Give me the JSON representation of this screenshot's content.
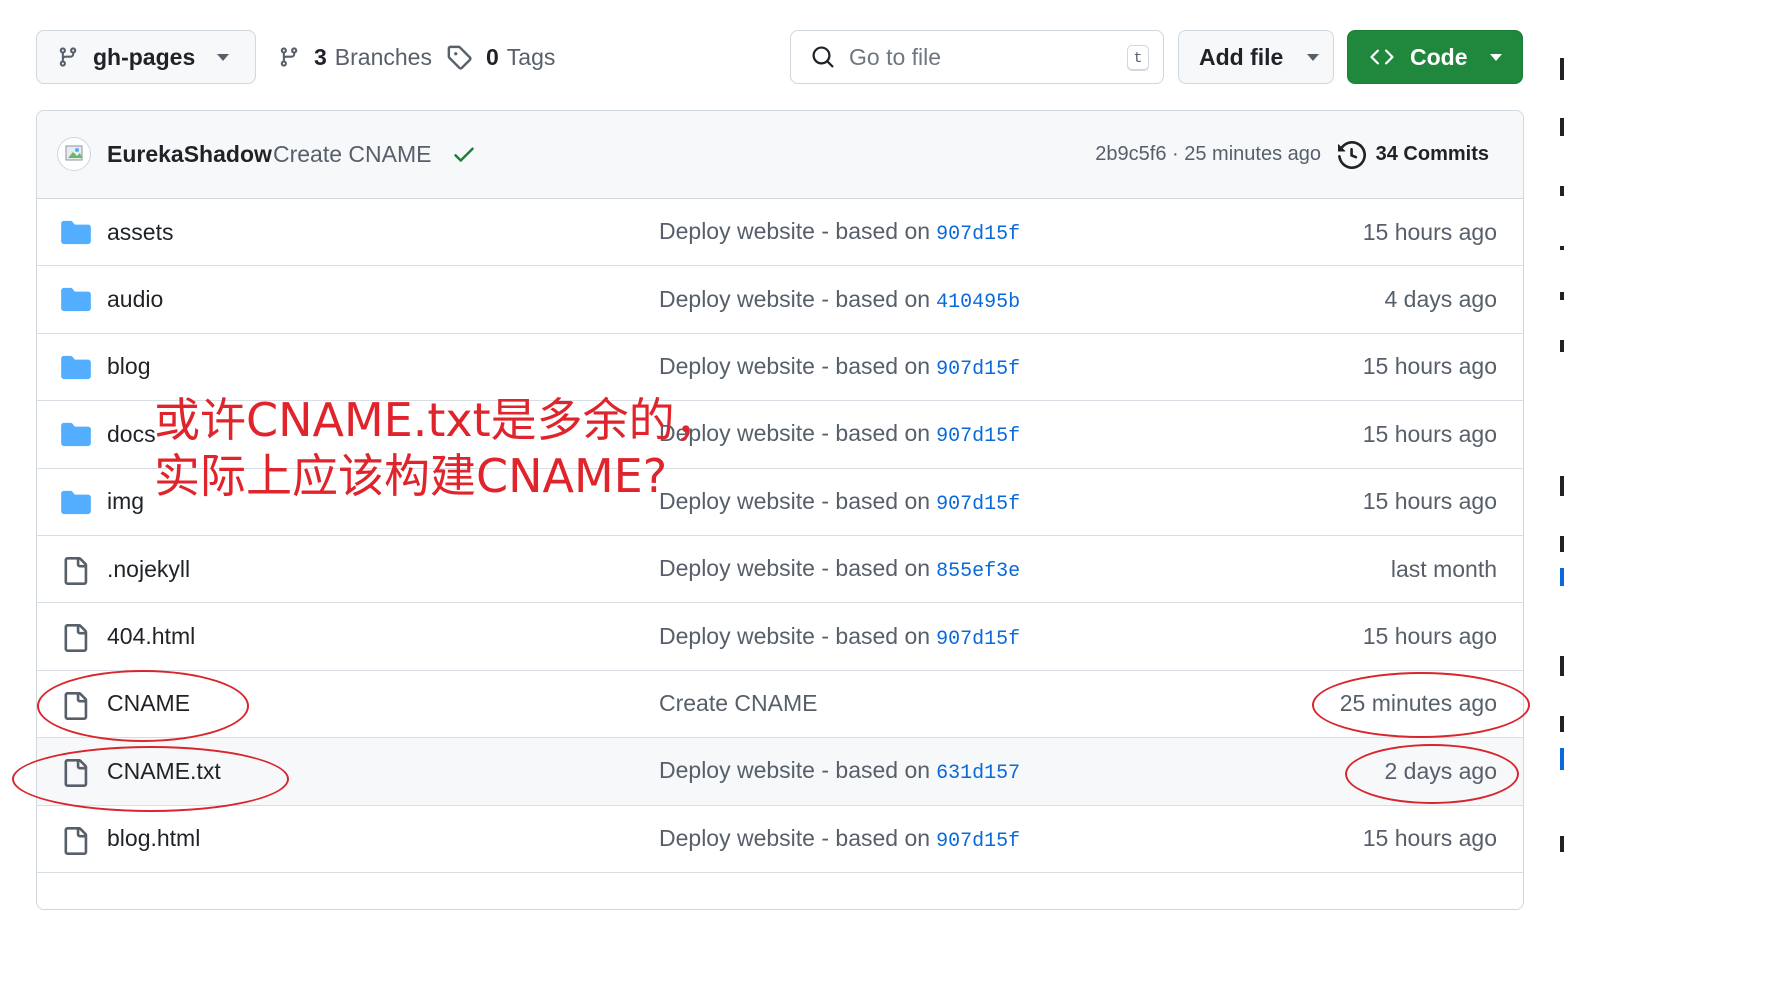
{
  "toolbar": {
    "branch_label": "gh-pages",
    "branches_count": "3",
    "branches_word": "Branches",
    "tags_count": "0",
    "tags_word": "Tags",
    "search_placeholder": "Go to file",
    "search_shortcut": "t",
    "add_file_label": "Add file",
    "code_label": "Code"
  },
  "latest_commit": {
    "author": "EurekaShadow",
    "message": "Create CNAME",
    "status": "check-icon",
    "sha_time": "2b9c5f6 · 25 minutes ago",
    "commits_label": "34 Commits"
  },
  "files": [
    {
      "type": "folder",
      "name": "assets",
      "message": "Deploy website - based on",
      "sha": "907d15f",
      "time": "15 hours ago"
    },
    {
      "type": "folder",
      "name": "audio",
      "message": "Deploy website - based on",
      "sha": "410495b",
      "time": "4 days ago"
    },
    {
      "type": "folder",
      "name": "blog",
      "message": "Deploy website - based on",
      "sha": "907d15f",
      "time": "15 hours ago"
    },
    {
      "type": "folder",
      "name": "docs",
      "message": "Deploy website - based on",
      "sha": "907d15f",
      "time": "15 hours ago"
    },
    {
      "type": "folder",
      "name": "img",
      "message": "Deploy website - based on",
      "sha": "907d15f",
      "time": "15 hours ago"
    },
    {
      "type": "file",
      "name": ".nojekyll",
      "message": "Deploy website - based on",
      "sha": "855ef3e",
      "time": "last month"
    },
    {
      "type": "file",
      "name": "404.html",
      "message": "Deploy website - based on",
      "sha": "907d15f",
      "time": "15 hours ago"
    },
    {
      "type": "file",
      "name": "CNAME",
      "message": "Create CNAME",
      "sha": "",
      "time": "25 minutes ago"
    },
    {
      "type": "file",
      "name": "CNAME.txt",
      "message": "Deploy website - based on",
      "sha": "631d157",
      "time": "2 days ago"
    },
    {
      "type": "file",
      "name": "blog.html",
      "message": "Deploy website - based on",
      "sha": "907d15f",
      "time": "15 hours ago"
    }
  ],
  "annotation": {
    "line1": "或许CNAME.txt是多余的，",
    "line2": "实际上应该构建CNAME?",
    "color": "#e0242b"
  },
  "colors": {
    "accent_green": "#1f883d",
    "link_blue": "#0969da",
    "folder_blue": "#54aeff",
    "muted_text": "#57606a"
  }
}
